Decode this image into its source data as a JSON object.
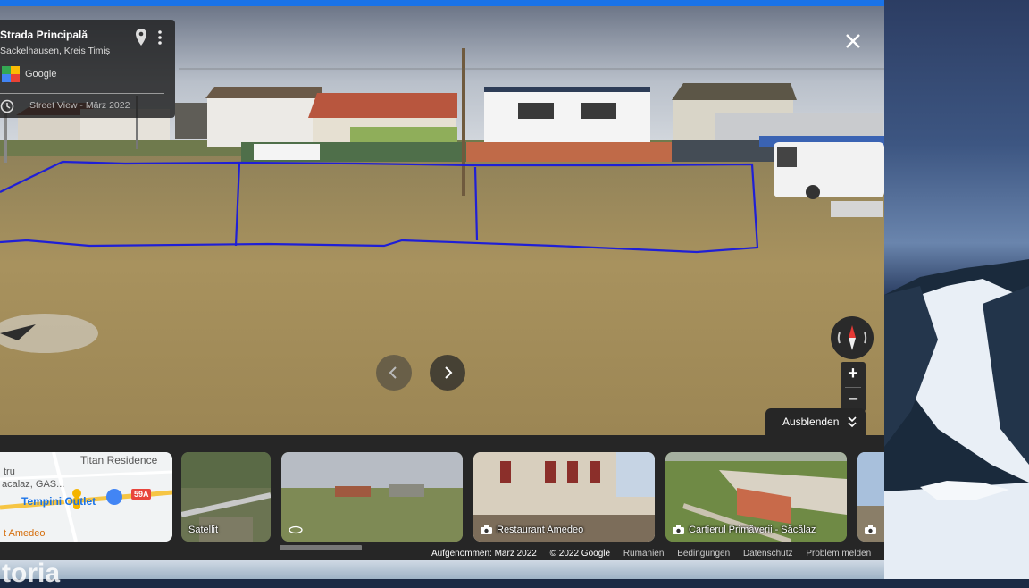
{
  "info": {
    "title": "Strada Principală",
    "subtitle": "Sackelhausen, Kreis Timiș",
    "brand": "Google",
    "capture": "Street View - März 2022"
  },
  "controls": {
    "hide_label": "Ausblenden",
    "zoom_in": "+",
    "zoom_out": "−"
  },
  "map_thumb": {
    "labels": [
      "Titan Residence",
      "tru",
      "acalaz, GAS...",
      "Tempini Outlet",
      "t Amedeo",
      "59A"
    ]
  },
  "thumbs": [
    {
      "caption": "Satellit"
    },
    {
      "caption": ""
    },
    {
      "caption": "Restaurant Amedeo"
    },
    {
      "caption": "Cartierul Primăverii - Săcălaz"
    }
  ],
  "footer": {
    "captured": "Aufgenommen: März 2022",
    "copyright": "© 2022 Google",
    "country": "Rumänien",
    "terms": "Bedingungen",
    "privacy": "Datenschutz",
    "report": "Problem melden"
  },
  "colors": {
    "accent": "#1a73e8",
    "panel": "#262626",
    "annotation": "#1f1fd6"
  },
  "icons": [
    "pin-icon",
    "more-vert-icon",
    "google-maps-logo",
    "clock-icon",
    "close-icon",
    "chevron-left-icon",
    "chevron-right-icon",
    "compass-icon",
    "chevron-double-down-icon",
    "camera-icon",
    "rotate-360-icon"
  ]
}
